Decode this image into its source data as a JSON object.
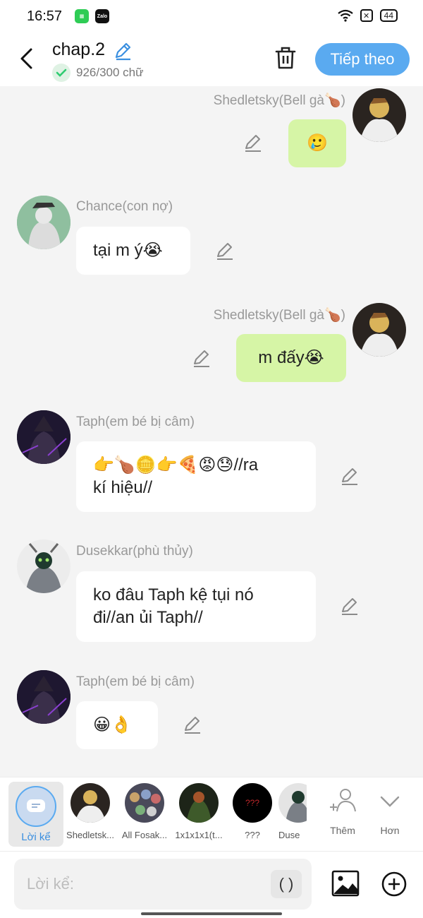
{
  "status_bar": {
    "time": "16:57",
    "battery": "44"
  },
  "header": {
    "title": "chap.2",
    "word_count": "926/300 chữ",
    "next_label": "Tiếp theo"
  },
  "messages": [
    {
      "name": "Shedletsky(Bell gà🍗)",
      "text": "🥲"
    },
    {
      "name": "Chance(con nợ)",
      "text": "tại m ý😭"
    },
    {
      "name": "Shedletsky(Bell gà🍗)",
      "text": "m đấy😭"
    },
    {
      "name": "Taph(em bé bị câm)",
      "line1": "👉🍗🪙👉🍕😡😓//ra",
      "line2": "kí hiệu//"
    },
    {
      "name": "Dusekkar(phù thủy)",
      "line1": "ko đâu Taph kệ tụi nó",
      "line2": "đi//an ủi Taph//"
    },
    {
      "name": "Taph(em bé bị câm)",
      "text": "😀👌"
    }
  ],
  "character_bar": {
    "narrator_label": "Lời kể",
    "characters": [
      "Shedletsk...",
      "All Fosak...",
      "1x1x1x1(t...",
      "???",
      "Duse"
    ],
    "more_label": "Thêm",
    "less_label": "Hơn"
  },
  "input": {
    "placeholder": "Lời kể:",
    "paren_label": "( )"
  },
  "colors": {
    "accent": "#5aaaf0",
    "right_bubble": "#d6f5a6",
    "left_bubble": "#ffffff",
    "background": "#f4f4f4"
  }
}
